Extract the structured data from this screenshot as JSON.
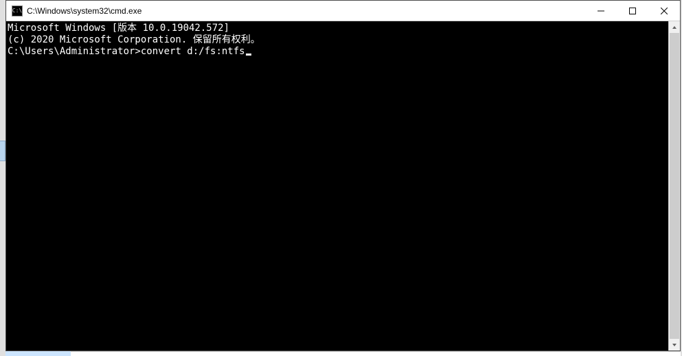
{
  "window": {
    "title": "C:\\Windows\\system32\\cmd.exe",
    "icon_label": "C:\\"
  },
  "terminal": {
    "line1": "Microsoft Windows [版本 10.0.19042.572]",
    "line2": "(c) 2020 Microsoft Corporation. 保留所有权利。",
    "blank": "",
    "prompt": "C:\\Users\\Administrator>",
    "command": "convert d:/fs:ntfs"
  }
}
